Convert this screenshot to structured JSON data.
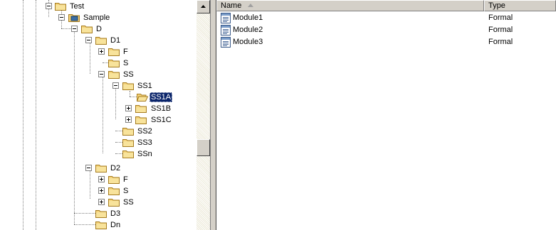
{
  "tree": {
    "nodes": [
      {
        "id": "test",
        "label": "Test",
        "expander": "minus",
        "icon": "folder-icon"
      },
      {
        "id": "sample",
        "label": "Sample",
        "expander": "minus",
        "icon": "project-icon"
      },
      {
        "id": "d",
        "label": "D",
        "expander": "minus",
        "icon": "folder-icon"
      },
      {
        "id": "d1",
        "label": "D1",
        "expander": "minus",
        "icon": "folder-icon"
      },
      {
        "id": "d1-f",
        "label": "F",
        "expander": "plus",
        "icon": "folder-icon"
      },
      {
        "id": "d1-s",
        "label": "S",
        "expander": "none",
        "icon": "folder-icon"
      },
      {
        "id": "d1-ss",
        "label": "SS",
        "expander": "minus",
        "icon": "folder-icon"
      },
      {
        "id": "ss1",
        "label": "SS1",
        "expander": "minus",
        "icon": "folder-icon"
      },
      {
        "id": "ss1a",
        "label": "SS1A",
        "expander": "none",
        "icon": "open-folder-icon",
        "selected": true
      },
      {
        "id": "ss1b",
        "label": "SS1B",
        "expander": "plus",
        "icon": "folder-icon"
      },
      {
        "id": "ss1c",
        "label": "SS1C",
        "expander": "plus",
        "icon": "folder-icon"
      },
      {
        "id": "ss2",
        "label": "SS2",
        "expander": "none",
        "icon": "folder-icon"
      },
      {
        "id": "ss3",
        "label": "SS3",
        "expander": "none",
        "icon": "folder-icon"
      },
      {
        "id": "ssn",
        "label": "SSn",
        "expander": "none",
        "icon": "folder-icon"
      },
      {
        "id": "d2",
        "label": "D2",
        "expander": "minus",
        "icon": "folder-icon"
      },
      {
        "id": "d2-f",
        "label": "F",
        "expander": "plus",
        "icon": "folder-icon"
      },
      {
        "id": "d2-s",
        "label": "S",
        "expander": "plus",
        "icon": "folder-icon"
      },
      {
        "id": "d2-ss",
        "label": "SS",
        "expander": "plus",
        "icon": "folder-icon"
      },
      {
        "id": "d3",
        "label": "D3",
        "expander": "none",
        "icon": "folder-icon"
      },
      {
        "id": "dn",
        "label": "Dn",
        "expander": "none",
        "icon": "folder-icon"
      }
    ]
  },
  "list": {
    "columns": {
      "name": "Name",
      "name_sort": "ascending",
      "type": "Type"
    },
    "rows": [
      {
        "name": "Module1",
        "type": "Formal",
        "icon": "module-icon"
      },
      {
        "name": "Module2",
        "type": "Formal",
        "icon": "module-icon"
      },
      {
        "name": "Module3",
        "type": "Formal",
        "icon": "module-icon"
      }
    ]
  },
  "colors": {
    "selection": "#0a246a",
    "chrome": "#d4d0c8",
    "folder": "#f4d27a"
  }
}
